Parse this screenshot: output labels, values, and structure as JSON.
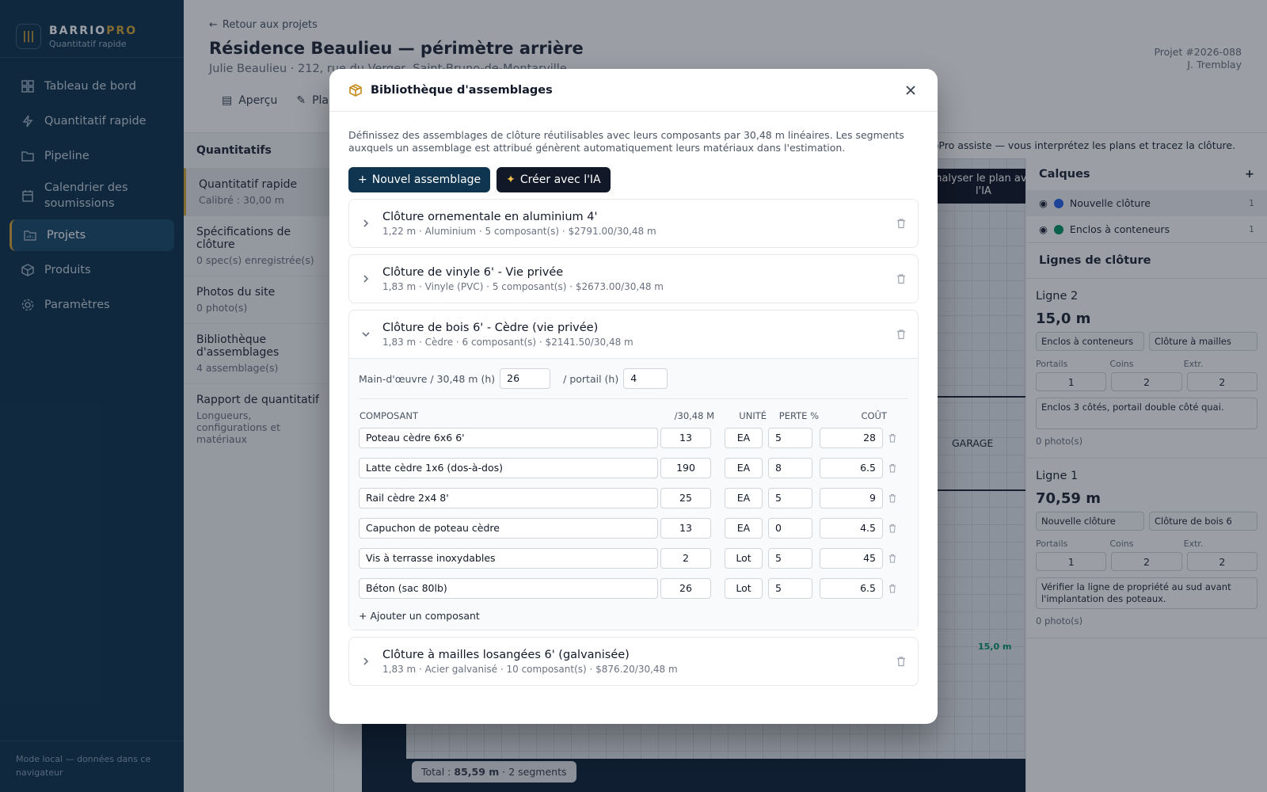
{
  "brand": {
    "name": "BARRIO",
    "name_accent": "PRO",
    "subtitle": "Quantitatif rapide",
    "logo_text": "|||"
  },
  "nav": [
    {
      "label": "Tableau de bord",
      "icon": "dashboard-icon"
    },
    {
      "label": "Quantitatif rapide",
      "icon": "bolt-icon"
    },
    {
      "label": "Pipeline",
      "icon": "folder-icon"
    },
    {
      "label": "Calendrier des soumissions",
      "icon": "calendar-icon"
    },
    {
      "label": "Projets",
      "icon": "chart-folder-icon",
      "active": true
    },
    {
      "label": "Produits",
      "icon": "box-icon"
    },
    {
      "label": "Paramètres",
      "icon": "gear-icon"
    }
  ],
  "sidebar_footer": "Mode local — données dans ce navigateur",
  "header": {
    "back": "Retour aux projets",
    "title": "Résidence Beaulieu — périmètre arrière",
    "subtitle": "Julie Beaulieu · 212, rue du Verger, Saint-Bruno-de-Montarville",
    "project_no": "Projet #2026-088",
    "owner": "J. Tremblay",
    "tabs": [
      "Aperçu",
      "Plan"
    ]
  },
  "subpanel": {
    "title": "Quantitatifs",
    "items": [
      {
        "title": "Quantitatif rapide",
        "desc": "Calibré : 30,00 m"
      },
      {
        "title": "Spécifications de clôture",
        "desc": "0 spec(s) enregistrée(s)"
      },
      {
        "title": "Photos du site",
        "desc": "0 photo(s)"
      },
      {
        "title": "Bibliothèque d'assemblages",
        "desc": "4 assemblage(s)"
      },
      {
        "title": "Rapport de quantitatif",
        "desc": "Longueurs, configurations et matériaux"
      }
    ]
  },
  "banner": "BarrioPro assiste — vous interprétez les plans et tracez la clôture.",
  "ai_analyze": "Analyser le plan avec l'IA",
  "canvas": {
    "garage": "GARAGE",
    "total_label": "Total :",
    "total_value": "85,59 m",
    "segments": "· 2 segments",
    "dim_label": "15,0 m"
  },
  "layers": {
    "title": "Calques",
    "items": [
      {
        "name": "Nouvelle clôture",
        "color": "#2563eb",
        "count": "1"
      },
      {
        "name": "Enclos à conteneurs",
        "color": "#059669",
        "count": "1"
      }
    ]
  },
  "lines": {
    "title": "Lignes de clôture",
    "items": [
      {
        "name": "Ligne 2",
        "length": "15,0 m",
        "layer": "Enclos à conteneurs",
        "assembly": "Clôture à mailles",
        "gates": "1",
        "corners": "2",
        "ends": "2",
        "note": "Enclos 3 côtés, portail double côté quai.",
        "photos": "0 photo(s)"
      },
      {
        "name": "Ligne 1",
        "length": "70,59 m",
        "layer": "Nouvelle clôture",
        "assembly": "Clôture de bois 6",
        "gates": "1",
        "corners": "2",
        "ends": "2",
        "note": "Vérifier la ligne de propriété au sud avant l'implantation des poteaux.",
        "photos": "0 photo(s)"
      }
    ],
    "labels": {
      "gates": "Portails",
      "corners": "Coins",
      "ends": "Extr."
    }
  },
  "modal": {
    "title": "Bibliothèque d'assemblages",
    "description": "Définissez des assemblages de clôture réutilisables avec leurs composants par 30,48 m linéaires. Les segments auxquels un assemblage est attribué génèrent automatiquement leurs matériaux dans l'estimation.",
    "new_button": "Nouvel assemblage",
    "ai_button": "Créer avec l'IA",
    "assemblies": [
      {
        "title": "Clôture ornementale en aluminium 4'",
        "sub": "1,22 m · Aluminium · 5 composant(s) · $2791.00/30,48 m"
      },
      {
        "title": "Clôture de vinyle 6' - Vie privée",
        "sub": "1,83 m · Vinyle (PVC) · 5 composant(s) · $2673.00/30,48 m"
      },
      {
        "title": "Clôture de bois 6' - Cèdre (vie privée)",
        "sub": "1,83 m · Cèdre · 6 composant(s) · $2141.50/30,48 m"
      },
      {
        "title": "Clôture à mailles losangées 6' (galvanisée)",
        "sub": "1,83 m · Acier galvanisé · 10 composant(s) · $876.20/30,48 m"
      }
    ],
    "expanded": {
      "labor_label": "Main-d'œuvre / 30,48 m (h)",
      "labor_value": "26",
      "gate_label": "/ portail (h)",
      "gate_value": "4",
      "headers": {
        "name": "COMPOSANT",
        "qty": "/30,48 M",
        "unit": "UNITÉ",
        "waste": "PERTE %",
        "cost": "COÛT"
      },
      "components": [
        {
          "name": "Poteau cèdre 6x6 6'",
          "qty": "13",
          "unit": "EA",
          "waste": "5",
          "cost": "28"
        },
        {
          "name": "Latte cèdre 1x6 (dos-à-dos)",
          "qty": "190",
          "unit": "EA",
          "waste": "8",
          "cost": "6.5"
        },
        {
          "name": "Rail cèdre 2x4 8'",
          "qty": "25",
          "unit": "EA",
          "waste": "5",
          "cost": "9"
        },
        {
          "name": "Capuchon de poteau cèdre",
          "qty": "13",
          "unit": "EA",
          "waste": "0",
          "cost": "4.5"
        },
        {
          "name": "Vis à terrasse inoxydables",
          "qty": "2",
          "unit": "Lot",
          "waste": "5",
          "cost": "45"
        },
        {
          "name": "Béton (sac 80lb)",
          "qty": "26",
          "unit": "Lot",
          "waste": "5",
          "cost": "6.5"
        }
      ],
      "add_component": "+ Ajouter un composant"
    }
  }
}
